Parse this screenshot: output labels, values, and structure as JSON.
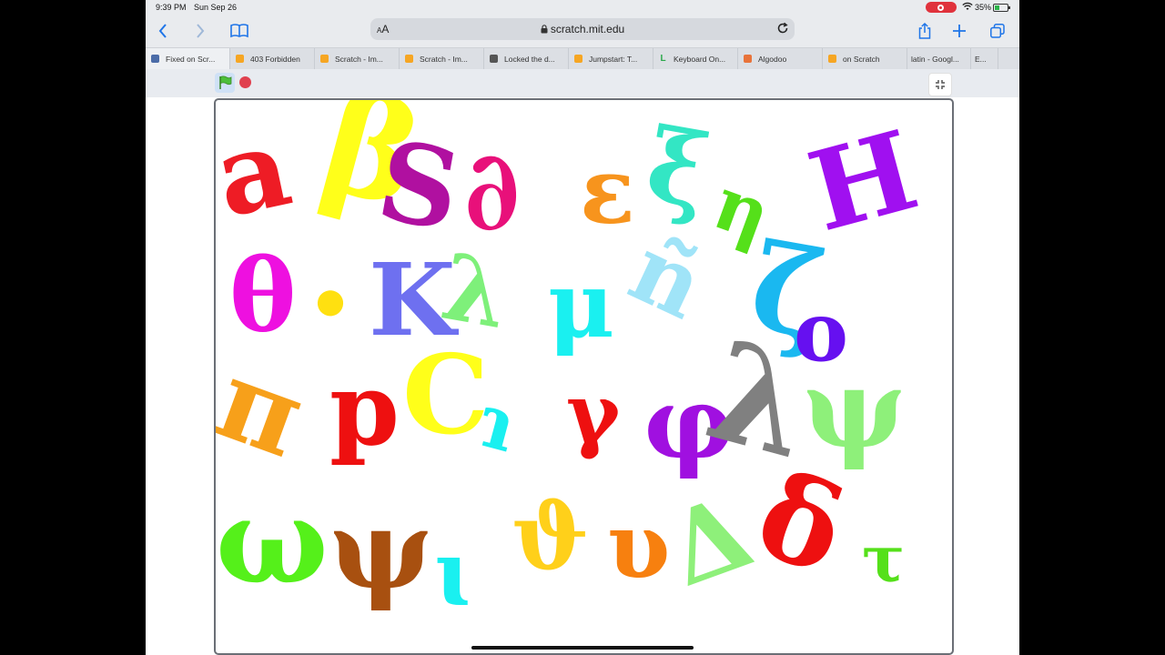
{
  "status_bar": {
    "time": "9:39 PM",
    "date": "Sun Sep 26",
    "battery": "35%"
  },
  "address_bar": {
    "text_size_label": "AA",
    "url": "scratch.mit.edu"
  },
  "tabs": [
    {
      "label": "Fixed on Scr...",
      "icon": "scratch-studio-favicon",
      "color": "#4c6ca8",
      "active": true
    },
    {
      "label": "403 Forbidden",
      "icon": "scratch-cat-favicon",
      "color": "#f6a623"
    },
    {
      "label": "Scratch - Im...",
      "icon": "scratch-cat-favicon",
      "color": "#f6a623"
    },
    {
      "label": "Scratch - Im...",
      "icon": "scratch-cat-favicon",
      "color": "#f6a623"
    },
    {
      "label": "Locked the d...",
      "icon": "roblox-favicon",
      "color": "#555555"
    },
    {
      "label": "Jumpstart: T...",
      "icon": "scratch-cat-favicon",
      "color": "#f6a623"
    },
    {
      "label": "Keyboard On...",
      "icon": "letter-l-favicon",
      "color": "#2aa84a",
      "glyph": "L"
    },
    {
      "label": "Algodoo",
      "icon": "algodoo-favicon",
      "color": "#e8733a"
    },
    {
      "label": "on Scratch",
      "icon": "scratch-cat-favicon",
      "color": "#f6a623"
    },
    {
      "label": "latin - Googl...",
      "icon": "none",
      "color": ""
    },
    {
      "label": "E...",
      "icon": "none",
      "color": ""
    }
  ],
  "stage": {
    "glyphs": [
      {
        "char": "a",
        "color": "#ee1c25"
      },
      {
        "char": "β",
        "color": "#ffff1a"
      },
      {
        "char": "S",
        "color": "#b010a0"
      },
      {
        "char": "∂",
        "color": "#e8107a"
      },
      {
        "char": "ε",
        "color": "#f7941d"
      },
      {
        "char": "ξ",
        "color": "#33e6c4"
      },
      {
        "char": "η",
        "color": "#55e01a"
      },
      {
        "char": "H",
        "color": "#a010f0"
      },
      {
        "char": "θ",
        "color": "#ee10e0"
      },
      {
        "char": "•",
        "color": "#ffe010"
      },
      {
        "char": "K",
        "color": "#6e70f0"
      },
      {
        "char": "λ",
        "color": "#7ef07a"
      },
      {
        "char": "μ",
        "color": "#1af0f0"
      },
      {
        "char": "ñ",
        "color": "#a0e4f8"
      },
      {
        "char": "ζ",
        "color": "#1ab8f0"
      },
      {
        "char": "o",
        "color": "#6610f0"
      },
      {
        "char": "π",
        "color": "#f7a01a"
      },
      {
        "char": "p",
        "color": "#ee1010"
      },
      {
        "char": "C",
        "color": "#ffff1a"
      },
      {
        "char": "ɿ",
        "color": "#1af0f0"
      },
      {
        "char": "γ",
        "color": "#ee1010"
      },
      {
        "char": "φ",
        "color": "#a010e0"
      },
      {
        "char": "λ",
        "color": "#808080"
      },
      {
        "char": "ψ",
        "color": "#8ef07a"
      },
      {
        "char": "ω",
        "color": "#55f01a"
      },
      {
        "char": "ψ",
        "color": "#a85010"
      },
      {
        "char": "ɩ",
        "color": "#1af0f0"
      },
      {
        "char": "ϑ",
        "color": "#ffd01a"
      },
      {
        "char": "υ",
        "color": "#f7800f"
      },
      {
        "char": "Δ",
        "color": "#8ef07a"
      },
      {
        "char": "δ",
        "color": "#ee1010"
      },
      {
        "char": "τ",
        "color": "#55e01a"
      }
    ]
  }
}
